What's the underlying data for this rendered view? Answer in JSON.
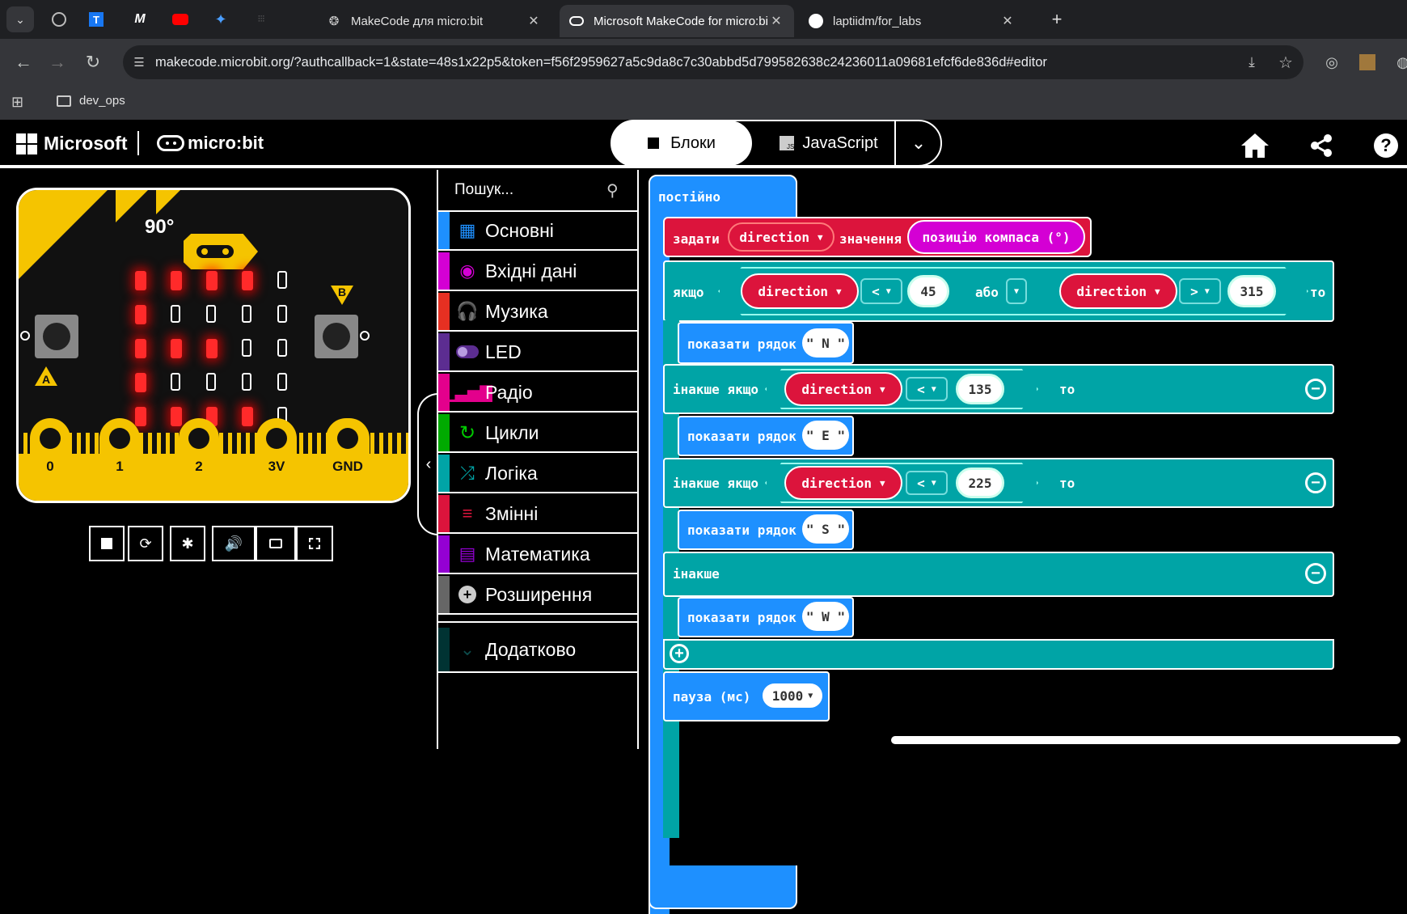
{
  "browser": {
    "tabs": [
      {
        "title": "MakeCode для micro:bit"
      },
      {
        "title": "Microsoft MakeCode for micro:bit"
      },
      {
        "title": "laptiidm/for_labs"
      }
    ],
    "url": "makecode.microbit.org/?authcallback=1&state=48s1x22p5&token=f56f2959627a5c9da8c7c30abbd5d799582638c24236011a09681efcf6de836d#editor",
    "bookmark_folder": "dev_ops"
  },
  "header": {
    "brand": "Microsoft",
    "product": "micro:bit",
    "tab_blocks": "Блоки",
    "tab_js": "JavaScript"
  },
  "simulator": {
    "compass": "90°",
    "btn_a": "A",
    "btn_b": "B",
    "pins": [
      "0",
      "1",
      "2",
      "3V",
      "GND"
    ]
  },
  "toolbox": {
    "search_placeholder": "Пошук...",
    "categories": [
      {
        "label": "Основні",
        "color": "#1e90ff"
      },
      {
        "label": "Вхідні дані",
        "color": "#d400d4"
      },
      {
        "label": "Музика",
        "color": "#e63022"
      },
      {
        "label": "LED",
        "color": "#5c2d91"
      },
      {
        "label": "Радіо",
        "color": "#e3008c"
      },
      {
        "label": "Цикли",
        "color": "#00aa00"
      },
      {
        "label": "Логіка",
        "color": "#00a4a6"
      },
      {
        "label": "Змінні",
        "color": "#dc143c"
      },
      {
        "label": "Математика",
        "color": "#9400d3"
      },
      {
        "label": "Розширення",
        "color": "#666666"
      },
      {
        "label": "Додатково",
        "color": "#003333"
      }
    ]
  },
  "blocks": {
    "forever": "постійно",
    "set": "задати",
    "var": "direction",
    "to": "значення",
    "compass": "позицію компаса (°)",
    "if": "якщо",
    "then": "то",
    "or": "або",
    "lt": "<",
    "gt": ">",
    "v45": "45",
    "v315": "315",
    "show": "показати рядок",
    "sN": "N",
    "elseif": "інакше якщо",
    "v135": "135",
    "sE": "E",
    "v225": "225",
    "sS": "S",
    "else": "інакше",
    "sW": "W",
    "pause": "пауза (мс)",
    "v1000": "1000"
  }
}
